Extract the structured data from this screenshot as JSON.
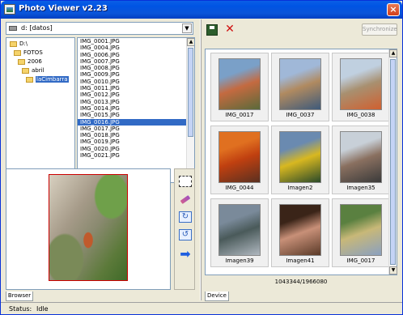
{
  "window": {
    "title": "Photo Viewer v2.23"
  },
  "drive": {
    "selected": "d: [datos]"
  },
  "tree": {
    "items": [
      {
        "label": "D:\\",
        "indent": 0,
        "selected": false
      },
      {
        "label": "FOTOS",
        "indent": 1,
        "selected": false
      },
      {
        "label": "2006",
        "indent": 2,
        "selected": false
      },
      {
        "label": "abril",
        "indent": 3,
        "selected": false
      },
      {
        "label": "laCimbarra",
        "indent": 4,
        "selected": true
      }
    ]
  },
  "files": {
    "items": [
      "IMG_0001.JPG",
      "IMG_0004.JPG",
      "IMG_0006.JPG",
      "IMG_0007.JPG",
      "IMG_0008.JPG",
      "IMG_0009.JPG",
      "IMG_0010.JPG",
      "IMG_0011.JPG",
      "IMG_0012.JPG",
      "IMG_0013.JPG",
      "IMG_0014.JPG",
      "IMG_0015.JPG",
      "IMG_0016.JPG",
      "IMG_0017.JPG",
      "IMG_0018.JPG",
      "IMG_0019.JPG",
      "IMG_0020.JPG",
      "IMG_0021.JPG"
    ],
    "selected_index": 12
  },
  "left_tab": {
    "label": "Browser"
  },
  "right_toolbar": {
    "sync_label": "Synchronize"
  },
  "thumbnails": [
    {
      "label": "IMG_0017",
      "landscape": false,
      "palette": [
        "#7aa0c8",
        "#c46a40",
        "#5a6a3a"
      ]
    },
    {
      "label": "IMG_0037",
      "landscape": false,
      "palette": [
        "#a0b8d8",
        "#b08a60",
        "#3e5a7a"
      ]
    },
    {
      "label": "IMG_0038",
      "landscape": false,
      "palette": [
        "#c0d0e0",
        "#a89070",
        "#d06030"
      ]
    },
    {
      "label": "IMG_0044",
      "landscape": false,
      "palette": [
        "#e07020",
        "#c04010",
        "#5a3020"
      ]
    },
    {
      "label": "Imagen2",
      "landscape": false,
      "palette": [
        "#6a8ab0",
        "#d8b820",
        "#2a4a2a"
      ]
    },
    {
      "label": "Imagen35",
      "landscape": false,
      "palette": [
        "#c8d0d8",
        "#8a7060",
        "#3a3a3a"
      ]
    },
    {
      "label": "Imagen39",
      "landscape": false,
      "palette": [
        "#7a8a9a",
        "#4a5a5a",
        "#b0b8c0"
      ]
    },
    {
      "label": "Imagen41",
      "landscape": false,
      "palette": [
        "#3a2418",
        "#c89078",
        "#5a3a28"
      ]
    },
    {
      "label": "IMG_0017",
      "landscape": false,
      "palette": [
        "#5a8040",
        "#c8b878",
        "#8aa0c0"
      ]
    }
  ],
  "storage": {
    "readout": "1043344/1966080"
  },
  "right_tab": {
    "label": "Device"
  },
  "status": {
    "label": "Status:",
    "value": "Idle"
  }
}
